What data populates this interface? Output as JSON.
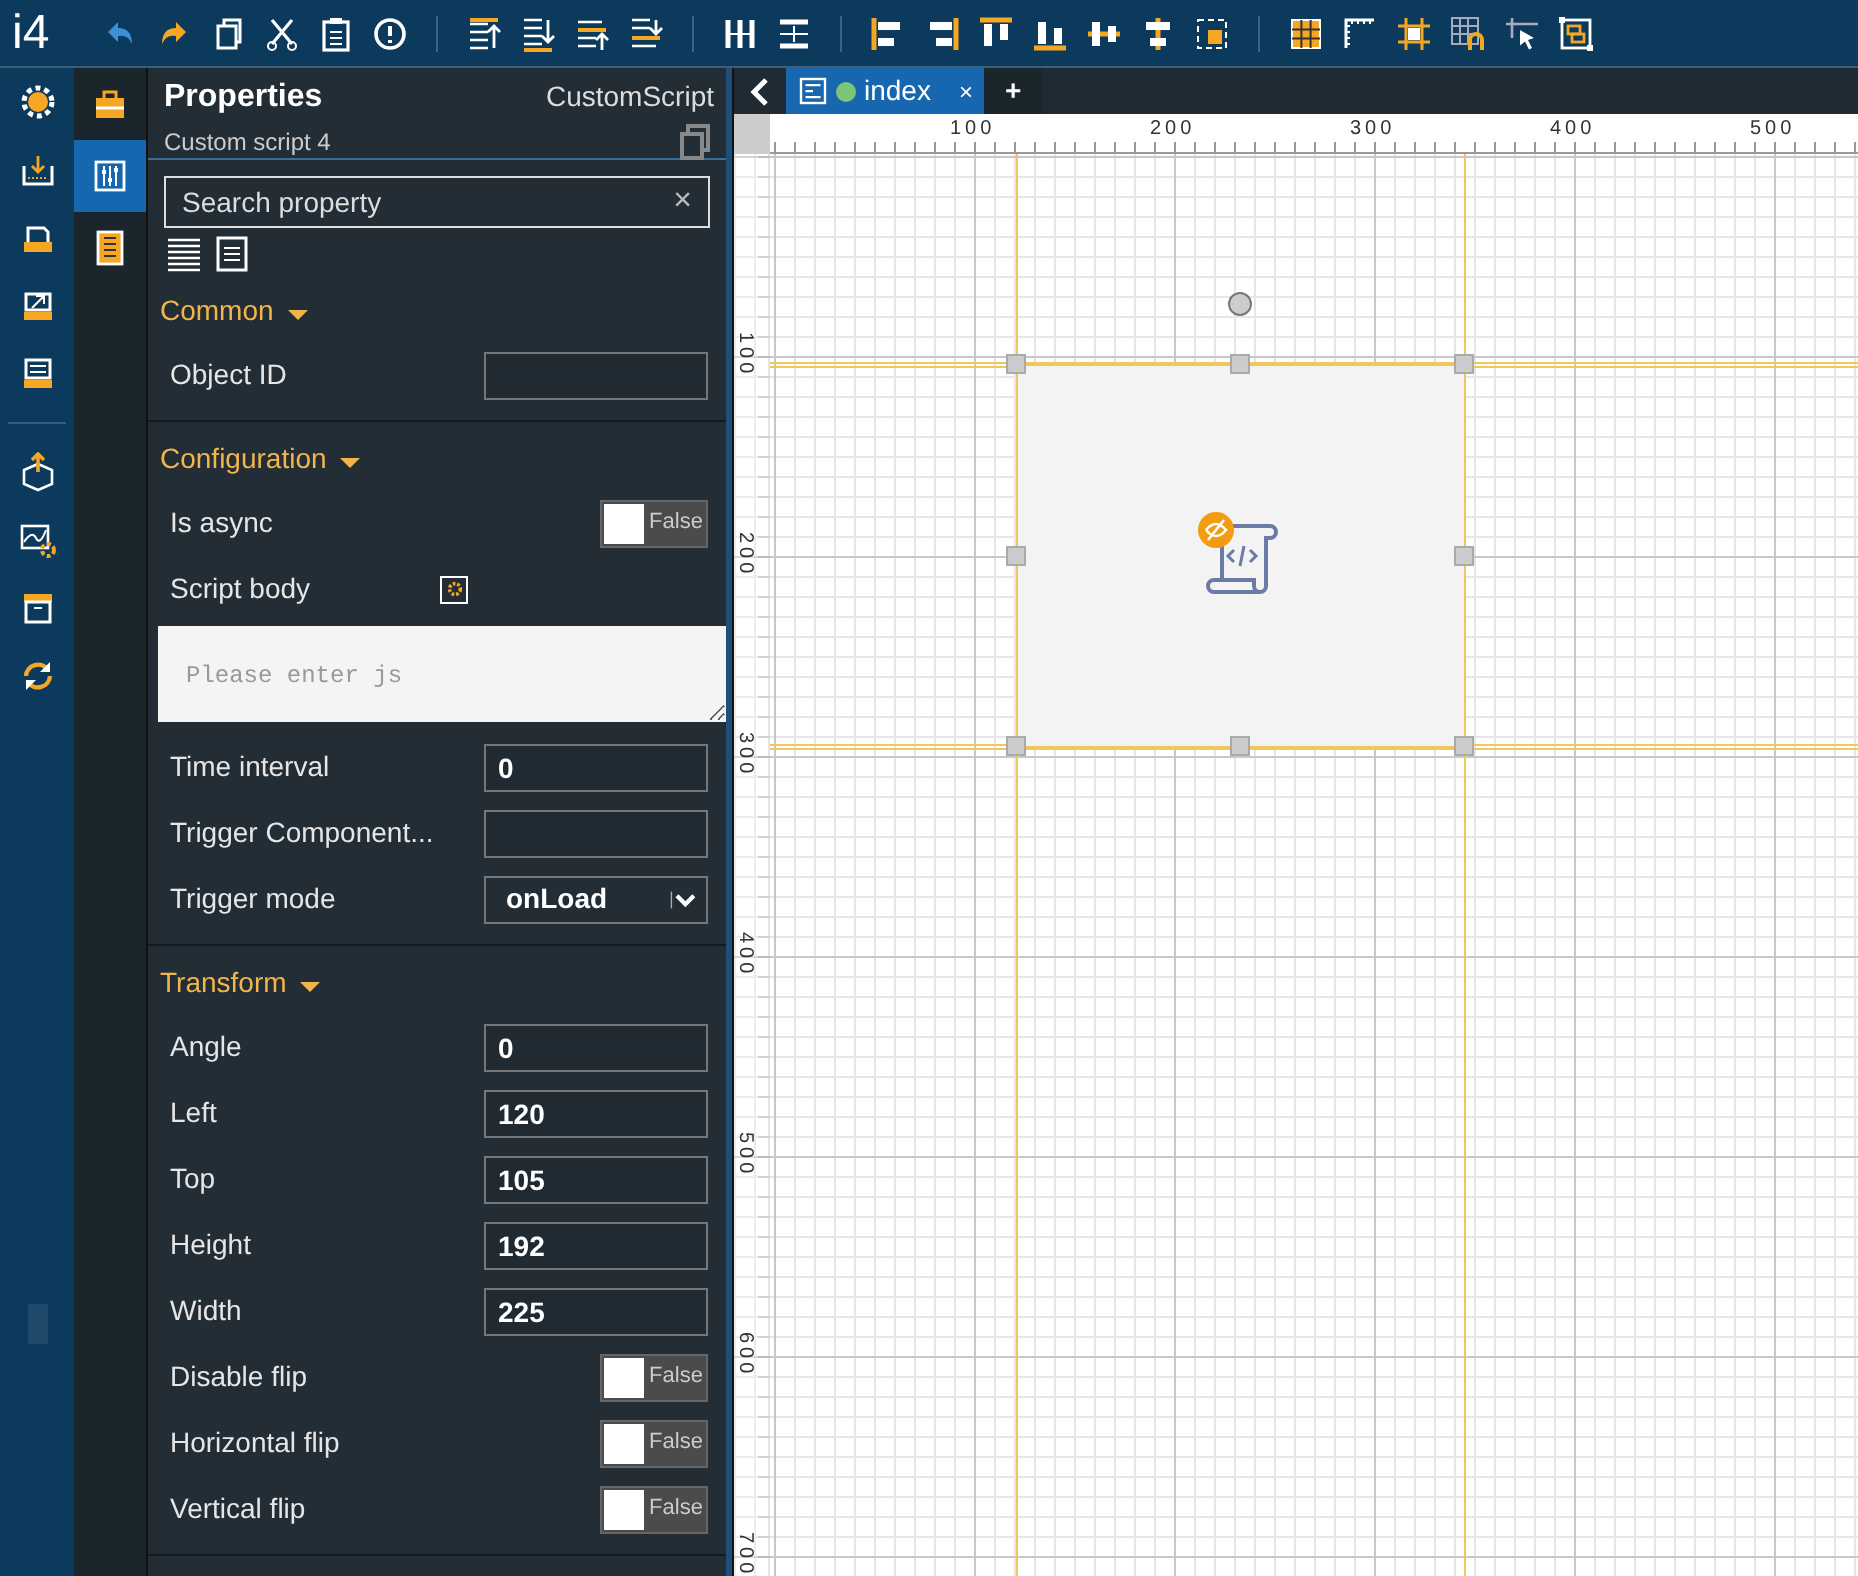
{
  "app": {
    "logo": "i4"
  },
  "panel_tabs": [
    {
      "selected": false
    },
    {
      "selected": true
    },
    {
      "selected": false
    }
  ],
  "properties": {
    "title": "Properties",
    "type": "CustomScript",
    "subtitle": "Custom script 4",
    "search": {
      "placeholder": "Search property",
      "clear": "×"
    },
    "sections": [
      {
        "title": "Common",
        "expanded": true,
        "rows": [
          {
            "kind": "input",
            "label": "Object ID"
          }
        ]
      },
      {
        "title": "Configuration",
        "expanded": true,
        "rows": [
          {
            "kind": "toggle",
            "label": "Is async",
            "on": false,
            "text": "False"
          },
          {
            "kind": "script",
            "label": "Script body"
          },
          {
            "kind": "textarea",
            "placeholder": "Please enter js"
          },
          {
            "kind": "input",
            "label": "Time interval",
            "value": "0"
          },
          {
            "kind": "input",
            "label": "Trigger Component..."
          },
          {
            "kind": "select",
            "label": "Trigger mode",
            "value": "onLoad"
          }
        ]
      },
      {
        "title": "Transform",
        "expanded": true,
        "rows": [
          {
            "kind": "input",
            "label": "Angle",
            "value": "0"
          },
          {
            "kind": "input",
            "label": "Left",
            "value": "120"
          },
          {
            "kind": "input",
            "label": "Top",
            "value": "105"
          },
          {
            "kind": "input",
            "label": "Height",
            "value": "192"
          },
          {
            "kind": "input",
            "label": "Width",
            "value": "225"
          },
          {
            "kind": "toggle",
            "label": "Disable flip",
            "on": false,
            "text": "False"
          },
          {
            "kind": "toggle",
            "label": "Horizontal flip",
            "on": false,
            "text": "False"
          },
          {
            "kind": "toggle",
            "label": "Vertical flip",
            "on": false,
            "text": "False"
          }
        ]
      }
    ]
  },
  "tabs": [
    {
      "label": "index",
      "selected": true,
      "close": "×"
    }
  ],
  "new_tab": "+",
  "canvas": {
    "x_ruler": [
      "100",
      "200",
      "300",
      "400",
      "500"
    ],
    "y_ruler": [
      "100",
      "200",
      "300",
      "400",
      "500",
      "600",
      "700"
    ]
  }
}
